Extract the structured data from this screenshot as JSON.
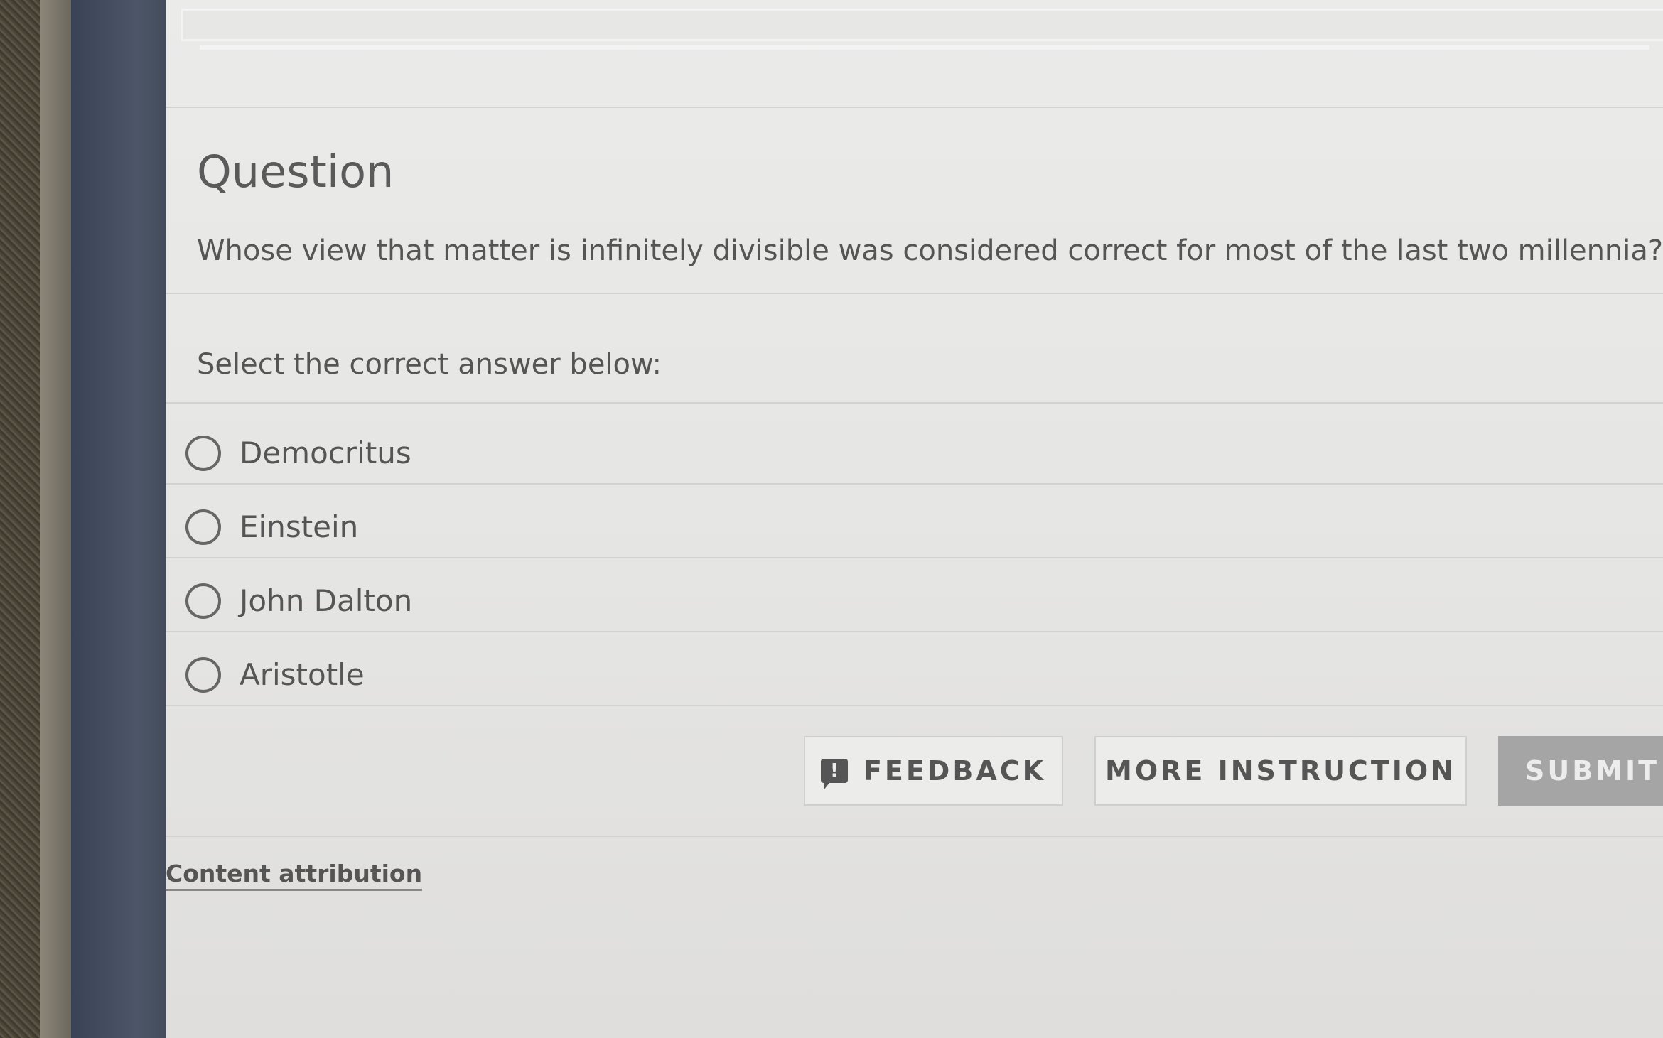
{
  "question": {
    "heading": "Question",
    "text": "Whose view that matter is infinitely divisible was considered correct for most of the last two millennia?"
  },
  "answers": {
    "instruction": "Select the correct answer below:",
    "options": [
      {
        "label": "Democritus",
        "selected": false
      },
      {
        "label": "Einstein",
        "selected": false
      },
      {
        "label": "John Dalton",
        "selected": false
      },
      {
        "label": "Aristotle",
        "selected": false
      }
    ]
  },
  "buttons": {
    "feedback": "FEEDBACK",
    "more_instruction": "MORE INSTRUCTION",
    "submit": "SUBMIT"
  },
  "footer": {
    "attribution": "Content attribution"
  },
  "icons": {
    "feedback": "feedback-icon",
    "radio": "radio-icon"
  },
  "colors": {
    "text": "#555555",
    "submit_background": "#a5a5a5",
    "sidebar": "#4d5668"
  }
}
